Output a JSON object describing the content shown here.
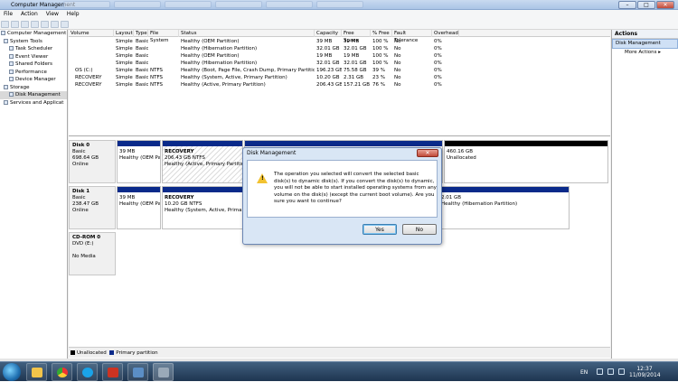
{
  "window": {
    "title": "Computer Management",
    "min": "–",
    "max": "□",
    "close": "✕"
  },
  "menu": [
    "File",
    "Action",
    "View",
    "Help"
  ],
  "tree": {
    "root": "Computer Management",
    "items": [
      {
        "label": "System Tools"
      },
      {
        "label": "Task Scheduler"
      },
      {
        "label": "Event Viewer"
      },
      {
        "label": "Shared Folders"
      },
      {
        "label": "Performance"
      },
      {
        "label": "Device Manager"
      },
      {
        "label": "Storage"
      },
      {
        "label": "Disk Management"
      },
      {
        "label": "Services and Applicat"
      }
    ]
  },
  "volume_table": {
    "headers": [
      "Volume",
      "Layout",
      "Type",
      "File System",
      "Status",
      "Capacity",
      "Free Space",
      "% Free",
      "Fault Tolerance",
      "Overhead"
    ],
    "rows": [
      [
        "",
        "Simple",
        "Basic",
        "",
        "Healthy (OEM Partition)",
        "39 MB",
        "39 MB",
        "100 %",
        "No",
        "0%"
      ],
      [
        "",
        "Simple",
        "Basic",
        "",
        "Healthy (Hibernation Partition)",
        "32.01 GB",
        "32.01 GB",
        "100 %",
        "No",
        "0%"
      ],
      [
        "",
        "Simple",
        "Basic",
        "",
        "Healthy (OEM Partition)",
        "19 MB",
        "19 MB",
        "100 %",
        "No",
        "0%"
      ],
      [
        "",
        "Simple",
        "Basic",
        "",
        "Healthy (Hibernation Partition)",
        "32.01 GB",
        "32.01 GB",
        "100 %",
        "No",
        "0%"
      ],
      [
        "OS (C:)",
        "Simple",
        "Basic",
        "NTFS",
        "Healthy (Boot, Page File, Crash Dump, Primary Partition)",
        "196.23 GB",
        "75.58 GB",
        "39 %",
        "No",
        "0%"
      ],
      [
        "RECOVERY",
        "Simple",
        "Basic",
        "NTFS",
        "Healthy (System, Active, Primary Partition)",
        "10.20 GB",
        "2.31 GB",
        "23 %",
        "No",
        "0%"
      ],
      [
        "RECOVERY",
        "Simple",
        "Basic",
        "NTFS",
        "Healthy (Active, Primary Partition)",
        "206.43 GB",
        "157.21 GB",
        "76 %",
        "No",
        "0%"
      ]
    ]
  },
  "disks": [
    {
      "name": "Disk 0",
      "type": "Basic",
      "size": "698.64 GB",
      "state": "Online",
      "parts": [
        {
          "title": "",
          "size": "39 MB",
          "status": "Healthy (OEM Par"
        },
        {
          "title": "RECOVERY",
          "size": "206.43 GB NTFS",
          "status": "Healthy (Active, Primary Partition"
        },
        {
          "title": "",
          "size": "460.16 GB",
          "status": "Unallocated"
        }
      ]
    },
    {
      "name": "Disk 1",
      "type": "Basic",
      "size": "238.47 GB",
      "state": "Online",
      "parts": [
        {
          "title": "",
          "size": "39 MB",
          "status": "Healthy (OEM Pa"
        },
        {
          "title": "RECOVERY",
          "size": "10.20 GB NTFS",
          "status": "Healthy (System, Active, Primary P"
        },
        {
          "title": "",
          "size": "2.01 GB",
          "status": "Healthy (Hibernation Partition)"
        }
      ]
    },
    {
      "name": "CD-ROM 0",
      "type": "DVD (E:)",
      "size": "",
      "state": "No Media"
    }
  ],
  "legend": {
    "unallocated": "Unallocated",
    "primary": "Primary partition"
  },
  "actions": {
    "header": "Actions",
    "selected": "Disk Management",
    "more": "More Actions"
  },
  "dialog": {
    "title": "Disk Management",
    "close": "✕",
    "message": "The operation you selected will convert the selected basic disk(s) to dynamic disk(s). If you convert the disk(s) to dynamic, you will not be able to start installed operating systems from any volume on the disk(s) (except the current boot volume). Are you sure you want to continue?",
    "yes": "Yes",
    "no": "No"
  },
  "taskbar": {
    "lang": "EN",
    "time": "12:37",
    "date": "11/09/2014"
  },
  "colors": {
    "primary_partition": "#0a2a8a",
    "unallocated": "#000000",
    "warning": "#f2c230"
  }
}
